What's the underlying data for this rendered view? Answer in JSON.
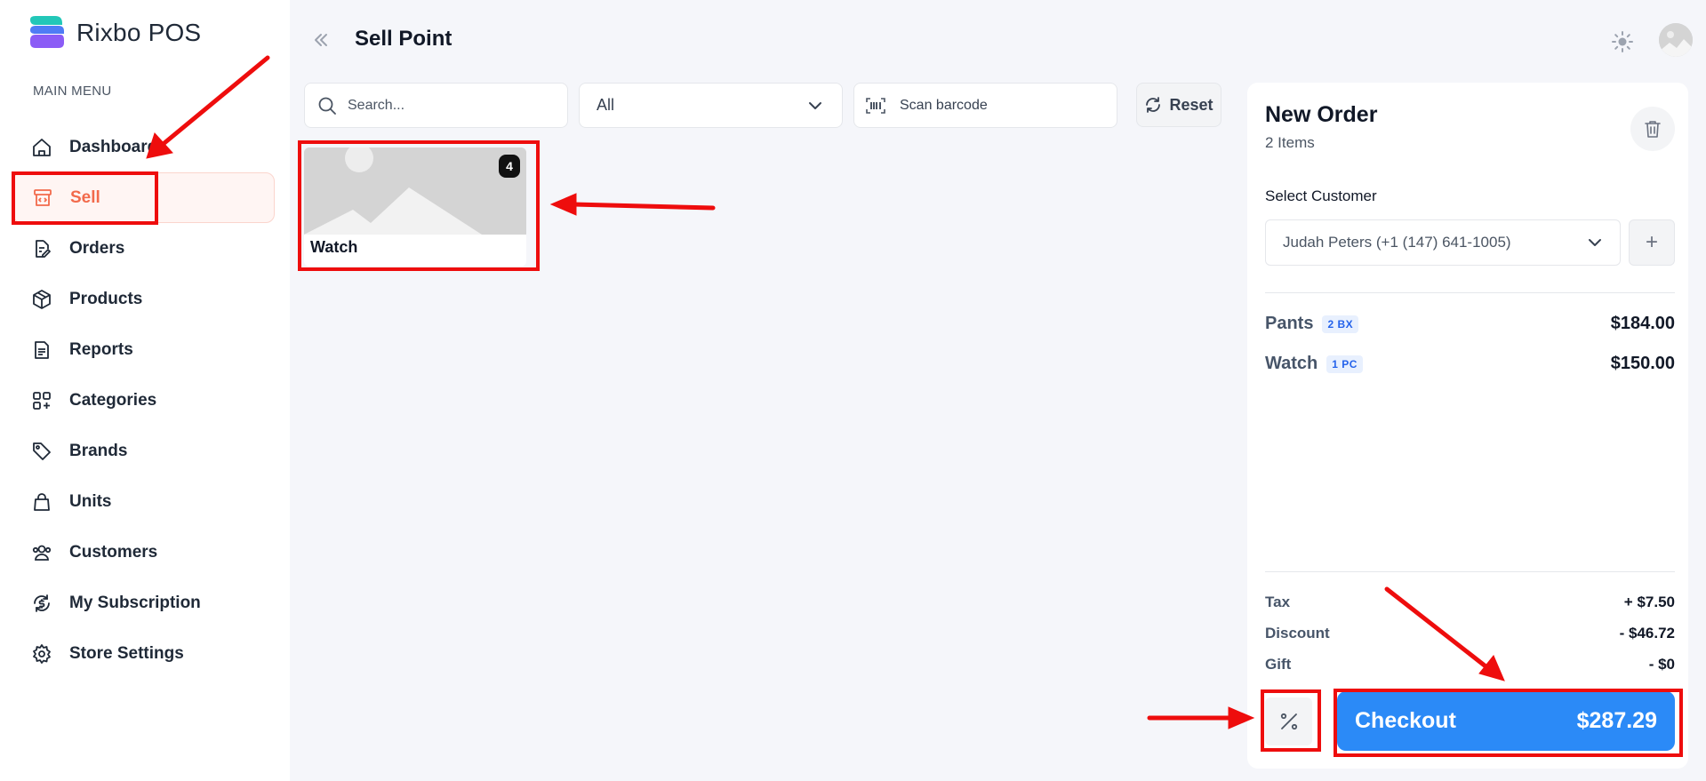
{
  "brand": {
    "name": "Rixbo POS",
    "accent": "#f26a4b"
  },
  "sidebar": {
    "menu_title": "MAIN MENU",
    "items": [
      {
        "label": "Dashboard",
        "icon": "home-icon"
      },
      {
        "label": "Sell",
        "icon": "register-icon",
        "active": true
      },
      {
        "label": "Orders",
        "icon": "document-edit-icon"
      },
      {
        "label": "Products",
        "icon": "box-icon"
      },
      {
        "label": "Reports",
        "icon": "report-icon"
      },
      {
        "label": "Categories",
        "icon": "grid-plus-icon"
      },
      {
        "label": "Brands",
        "icon": "tag-icon"
      },
      {
        "label": "Units",
        "icon": "bag-icon"
      },
      {
        "label": "Customers",
        "icon": "users-icon"
      },
      {
        "label": "My Subscription",
        "icon": "dollar-refresh-icon"
      },
      {
        "label": "Store Settings",
        "icon": "gear-icon"
      }
    ]
  },
  "header": {
    "title": "Sell Point"
  },
  "toolbar": {
    "search_placeholder": "Search...",
    "category_selected": "All",
    "scan_label": "Scan barcode",
    "reset_label": "Reset"
  },
  "products": [
    {
      "name": "Watch",
      "qty": "4"
    }
  ],
  "order": {
    "title": "New Order",
    "count": "2 Items",
    "customer_label": "Select Customer",
    "customer_selected": "Judah Peters (+1 (147) 641-1005)",
    "add_symbol": "+",
    "items": [
      {
        "name": "Pants",
        "unit": "2 BX",
        "price": "$184.00"
      },
      {
        "name": "Watch",
        "unit": "1 PC",
        "price": "$150.00"
      }
    ],
    "summary": [
      {
        "label": "Tax",
        "value": "+ $7.50"
      },
      {
        "label": "Discount",
        "value": "- $46.72"
      },
      {
        "label": "Gift",
        "value": "- $0"
      }
    ],
    "checkout_label": "Checkout",
    "checkout_total": "$287.29",
    "checkout_color": "#2b8af7"
  },
  "annotation_color": "#ee0d0d"
}
